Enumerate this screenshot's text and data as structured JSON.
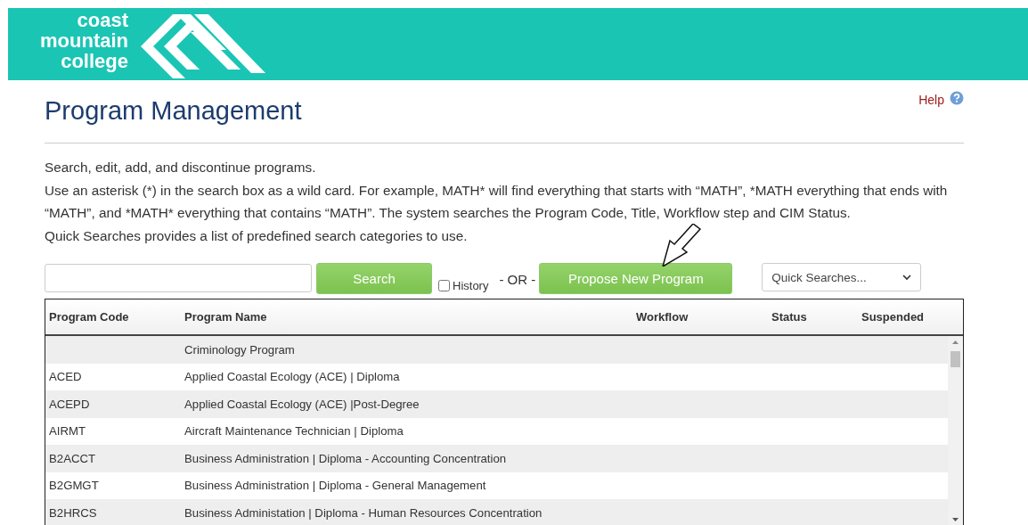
{
  "header": {
    "logo_lines": [
      "coast",
      "mountain",
      "college"
    ]
  },
  "help": {
    "label": "Help"
  },
  "title": "Program Management",
  "intro": [
    "Search, edit, add, and discontinue programs.",
    "Use an asterisk (*) in the search box as a wild card. For example, MATH* will find everything that starts with “MATH”, *MATH everything that ends with “MATH”, and *MATH* everything that contains “MATH”. The system searches the Program Code, Title, Workflow step and CIM Status.",
    "Quick Searches provides a list of predefined search categories to use."
  ],
  "search": {
    "button": "Search",
    "history_label": "History",
    "history_checked": false,
    "or_label": "- OR -",
    "propose_button": "Propose New Program",
    "quick_searches": "Quick Searches..."
  },
  "table": {
    "columns": [
      "Program Code",
      "Program Name",
      "Workflow",
      "Status",
      "Suspended"
    ],
    "rows": [
      {
        "code": "",
        "name": "Criminology Program"
      },
      {
        "code": "ACED",
        "name": "Applied Coastal Ecology (ACE) | Diploma"
      },
      {
        "code": "ACEPD",
        "name": "Applied Coastal Ecology (ACE) |Post-Degree"
      },
      {
        "code": "AIRMT",
        "name": "Aircraft Maintenance Technician | Diploma"
      },
      {
        "code": "B2ACCT",
        "name": "Business Administration | Diploma - Accounting Concentration"
      },
      {
        "code": "B2GMGT",
        "name": "Business Administration | Diploma - General Management"
      },
      {
        "code": "B2HRCS",
        "name": "Business Administation | Diploma - Human Resources Concentration"
      }
    ]
  }
}
